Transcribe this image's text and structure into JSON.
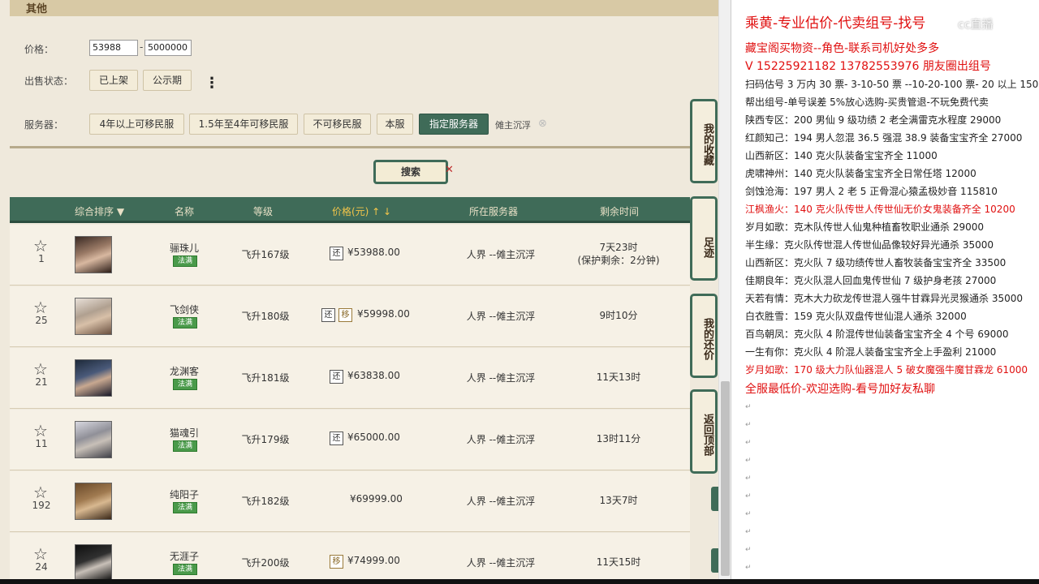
{
  "game": {
    "section_title": "其他",
    "filters": {
      "price_label": "价格：",
      "price_min": "53988",
      "price_sep": "-",
      "price_max": "5000000",
      "status_label": "出售状态：",
      "status_buttons": [
        "已上架",
        "公示期"
      ],
      "more_glyph": "⋮",
      "server_label": "服务器：",
      "server_buttons": [
        "4年以上可移民服",
        "1.5年至4年可移民服",
        "不可移民服",
        "本服",
        "指定服务器"
      ],
      "selected_server": "傩主沉浮",
      "clear_glyph": "⊗"
    },
    "search_label": "搜索",
    "search_x": "✕",
    "table": {
      "headers": {
        "sort": "综合排序 ▼",
        "name": "名称",
        "level": "等级",
        "price": "价格(元) ↑ ↓",
        "server": "所在服务器",
        "remaining": "剩余时间"
      },
      "rows": [
        {
          "rank": "1",
          "name": "骊珠儿",
          "tag": "法满",
          "level": "飞升167级",
          "badges": [
            "还"
          ],
          "price": "¥53988.00",
          "server": "人界 --傩主沉浮",
          "time": "7天23时",
          "time2": "(保护剩余：2分钟)"
        },
        {
          "rank": "25",
          "name": "飞剑侠",
          "tag": "法满",
          "level": "飞升180级",
          "badges": [
            "还",
            "移"
          ],
          "price": "¥59998.00",
          "server": "人界 --傩主沉浮",
          "time": "9时10分",
          "time2": ""
        },
        {
          "rank": "21",
          "name": "龙渊客",
          "tag": "法满",
          "level": "飞升181级",
          "badges": [
            "还"
          ],
          "price": "¥63838.00",
          "server": "人界 --傩主沉浮",
          "time": "11天13时",
          "time2": ""
        },
        {
          "rank": "11",
          "name": "猫魂引",
          "tag": "法满",
          "level": "飞升179级",
          "badges": [
            "还"
          ],
          "price": "¥65000.00",
          "server": "人界 --傩主沉浮",
          "time": "13时11分",
          "time2": ""
        },
        {
          "rank": "192",
          "name": "纯阳子",
          "tag": "法满",
          "level": "飞升182级",
          "badges": [],
          "price": "¥69999.00",
          "server": "人界 --傩主沉浮",
          "time": "13天7时",
          "time2": ""
        },
        {
          "rank": "24",
          "name": "无涯子",
          "tag": "法满",
          "level": "飞升200级",
          "badges": [
            "移"
          ],
          "price": "¥74999.00",
          "server": "人界 --傩主沉浮",
          "time": "11天15时",
          "time2": ""
        }
      ]
    },
    "side_nav": [
      "我的收藏",
      "足迹",
      "我的还价",
      "返回顶部"
    ],
    "star_glyph": "☆"
  },
  "doc": {
    "title": "乘黄-专业估价-代卖组号-找号",
    "watermark": "cc直播",
    "lines": [
      {
        "text": "藏宝阁买物资--角色-联系司机好处多多",
        "red": true
      },
      {
        "text": "V 15225921182       13782553976 朋友圈出组号",
        "red": true
      },
      {
        "text": "扫码估号 3 万内 30 票- 3-10-50 票  --10-20-100 票- 20 以上 150",
        "red": false
      },
      {
        "text": "帮出组号-单号误差 5%放心选购-买贵管退-不玩免费代卖",
        "red": false
      },
      {
        "text": "陕西专区：200 男仙 9 级功绩 2 老全满雷克水程度 29000",
        "red": false
      },
      {
        "text": "红颜知己：194 男人忽混 36.5 强混 38.9 装备宝宝齐全 27000",
        "red": false
      },
      {
        "text": "山西新区：140 克火队装备宝宝齐全 11000",
        "red": false
      },
      {
        "text": "虎啸神州：140 克火队装备宝宝齐全日常任塔 12000",
        "red": false
      },
      {
        "text": "剑蚀沧海：197 男人 2 老 5 正骨混心猿孟极妙音 115810",
        "red": false
      },
      {
        "text": "江枫渔火：140 克火队传世人传世仙无价女鬼装备齐全 10200",
        "red": true
      },
      {
        "text": "岁月如歌：克木队传世人仙鬼种植畜牧职业通杀 29000",
        "red": false
      },
      {
        "text": "半生缘：克火队传世混人传世仙品像较好异光通杀 35000",
        "red": false
      },
      {
        "text": "山西新区：克火队 7 级功绩传世人畜牧装备宝宝齐全 33500",
        "red": false
      },
      {
        "text": "佳期良年：克火队混人回血鬼传世仙 7 级护身老孩 27000",
        "red": false
      },
      {
        "text": "天若有情：克木大力砍龙传世混人强牛甘霖异光灵猴通杀 35000",
        "red": false
      },
      {
        "text": "白衣胜雪：159 克火队双盘传世仙混人通杀 32000",
        "red": false
      },
      {
        "text": "百鸟朝凤：克火队 4 阶混传世仙装备宝宝齐全 4 个号 69000",
        "red": false
      },
      {
        "text": "一生有你：克火队 4 阶混人装备宝宝齐全上手盈利 21000",
        "red": false
      },
      {
        "text": "岁月如歌：170 级大力队仙器混人 5 破女魔强牛魔甘霖龙 61000",
        "red": true
      },
      {
        "text": "全服最低价-欢迎选购-看号加好友私聊",
        "red": true
      }
    ],
    "pmark": "↵"
  }
}
